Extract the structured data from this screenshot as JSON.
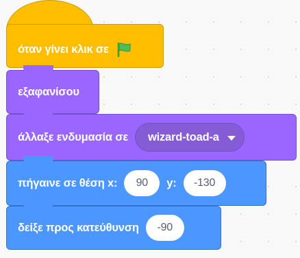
{
  "colors": {
    "events": "#ffbf00",
    "looks": "#9966ff",
    "motion": "#4c97ff",
    "flag": "#4cbf56"
  },
  "script": {
    "when_flag_clicked": {
      "label": "όταν γίνει κλικ σε",
      "icon": "green-flag-icon"
    },
    "hide": {
      "label": "εξαφανίσου"
    },
    "switch_costume": {
      "label": "άλλαξε ενδυμασία σε",
      "costume": "wizard-toad-a",
      "icon": "dropdown-caret-icon"
    },
    "go_to_xy": {
      "label": "πήγαινε σε θέση x:",
      "x_value": "90",
      "y_label": "y:",
      "y_value": "-130"
    },
    "point_in_direction": {
      "label": "δείξε προς κατεύθυνση",
      "direction": "-90"
    }
  }
}
